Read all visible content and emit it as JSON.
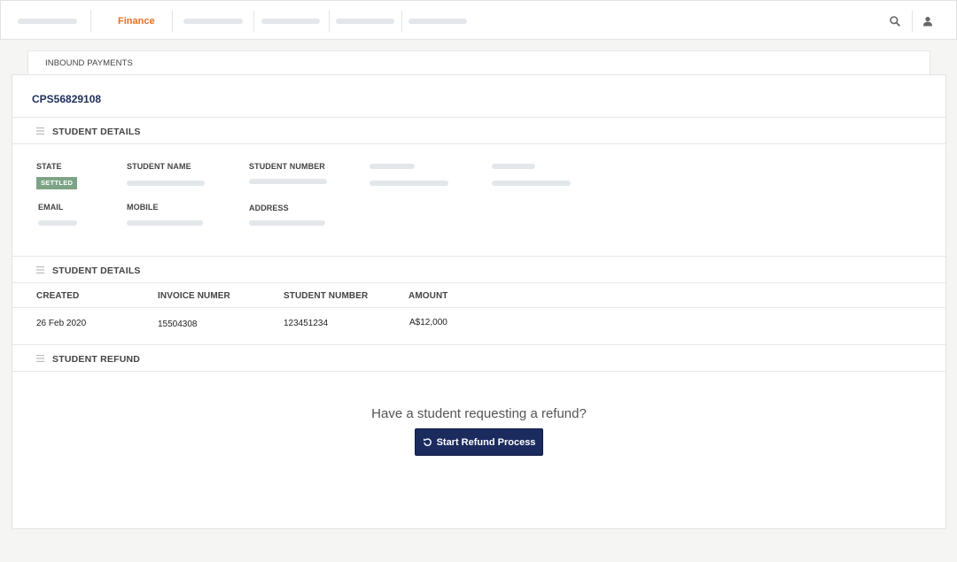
{
  "nav": {
    "active_item": "Finance",
    "active_color": "#e8702a",
    "icons": [
      "search-icon",
      "user-icon"
    ]
  },
  "tab": {
    "label": "INBOUND PAYMENTS"
  },
  "payment": {
    "reference": "CPS56829108"
  },
  "student_details": {
    "title": "STUDENT DETAILS",
    "fields": {
      "state_label": "STATE",
      "state_value": "SETTLED",
      "state_color": "#7da386",
      "name_label": "STUDENT NAME",
      "number_label": "STUDENT NUMBER",
      "email_label": "EMAIL",
      "mobile_label": "MOBILE",
      "address_label": "ADDRESS"
    }
  },
  "invoice_details": {
    "title": "STUDENT DETAILS",
    "columns": [
      "CREATED",
      "INVOICE NUMER",
      "STUDENT NUMBER",
      "AMOUNT"
    ],
    "rows": [
      {
        "created": "26 Feb 2020",
        "invoice_number": "15504308",
        "student_number": "123451234",
        "amount": "A$12,000"
      }
    ]
  },
  "refund": {
    "title": "STUDENT REFUND",
    "question": "Have a student requesting a refund?",
    "button_label": "Start Refund Process",
    "button_color": "#1c2b5e",
    "button_icon": "undo-icon"
  }
}
